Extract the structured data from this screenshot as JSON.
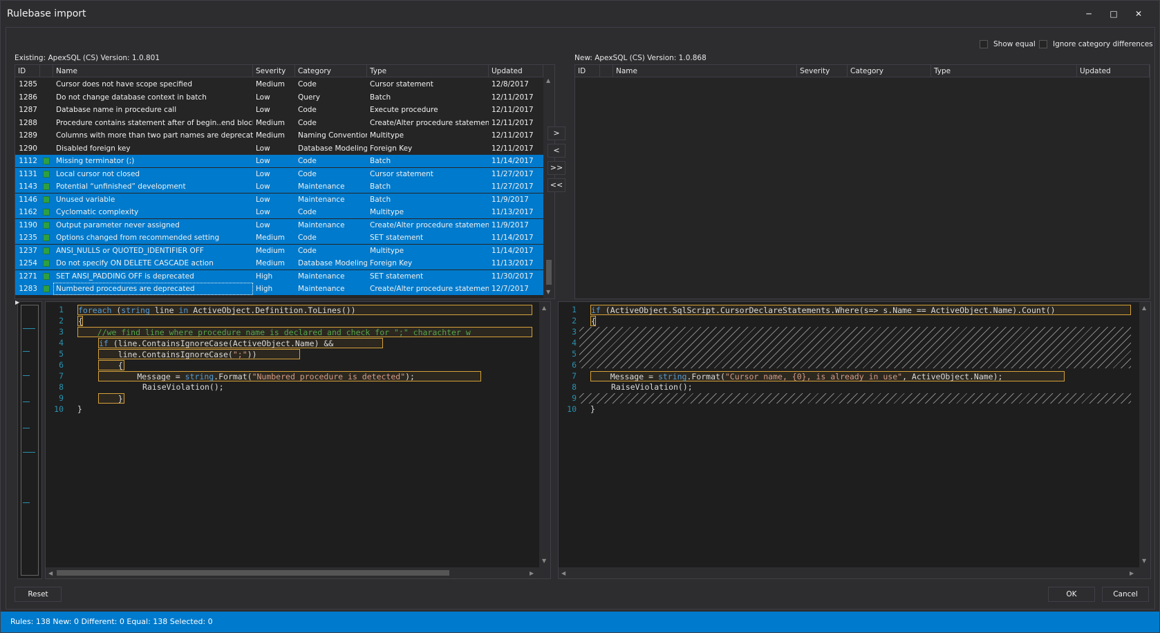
{
  "window": {
    "title": "Rulebase import"
  },
  "options": {
    "show_equal": "Show equal",
    "ignore_category": "Ignore category differences"
  },
  "existing": {
    "label": "Existing: ApexSQL (CS)  Version: 1.0.801",
    "columns": [
      "ID",
      "Name",
      "Severity",
      "Category",
      "Type",
      "Updated"
    ],
    "rows": [
      {
        "id": "1285",
        "name": "Cursor does not have scope specified",
        "severity": "Medium",
        "category": "Code",
        "type": "Cursor statement",
        "updated": "12/8/2017",
        "selected": false
      },
      {
        "id": "1286",
        "name": "Do not change database context in batch",
        "severity": "Low",
        "category": "Query",
        "type": "Batch",
        "updated": "12/11/2017",
        "selected": false
      },
      {
        "id": "1287",
        "name": "Database name in procedure call",
        "severity": "Low",
        "category": "Code",
        "type": "Execute procedure",
        "updated": "12/11/2017",
        "selected": false
      },
      {
        "id": "1288",
        "name": "Procedure contains statement after of begin..end block",
        "severity": "Medium",
        "category": "Code",
        "type": "Create/Alter procedure statement",
        "updated": "12/11/2017",
        "selected": false
      },
      {
        "id": "1289",
        "name": "Columns with more than two part names are deprecated",
        "severity": "Medium",
        "category": "Naming Convention",
        "type": "Multitype",
        "updated": "12/11/2017",
        "selected": false
      },
      {
        "id": "1290",
        "name": "Disabled foreign key",
        "severity": "Low",
        "category": "Database Modeling",
        "type": "Foreign Key",
        "updated": "12/11/2017",
        "selected": false
      },
      {
        "id": "1112",
        "name": "Missing terminator (;)",
        "severity": "Low",
        "category": "Code",
        "type": "Batch",
        "updated": "11/14/2017",
        "selected": true
      },
      {
        "id": "1131",
        "name": "Local cursor not closed",
        "severity": "Low",
        "category": "Code",
        "type": "Cursor statement",
        "updated": "11/27/2017",
        "selected": true
      },
      {
        "id": "1143",
        "name": "Potential “unfinished” development",
        "severity": "Low",
        "category": "Maintenance",
        "type": "Batch",
        "updated": "11/27/2017",
        "selected": true
      },
      {
        "id": "1146",
        "name": "Unused variable",
        "severity": "Low",
        "category": "Maintenance",
        "type": "Batch",
        "updated": "11/9/2017",
        "selected": true
      },
      {
        "id": "1162",
        "name": "Cyclomatic complexity",
        "severity": "Low",
        "category": "Code",
        "type": "Multitype",
        "updated": "11/13/2017",
        "selected": true
      },
      {
        "id": "1190",
        "name": "Output parameter never assigned",
        "severity": "Low",
        "category": "Maintenance",
        "type": "Create/Alter procedure statement",
        "updated": "11/9/2017",
        "selected": true
      },
      {
        "id": "1235",
        "name": "Options changed from recommended setting",
        "severity": "Medium",
        "category": "Code",
        "type": "SET statement",
        "updated": "11/14/2017",
        "selected": true
      },
      {
        "id": "1237",
        "name": "ANSI_NULLS or QUOTED_IDENTIFIER  OFF",
        "severity": "Medium",
        "category": "Code",
        "type": "Multitype",
        "updated": "11/14/2017",
        "selected": true
      },
      {
        "id": "1254",
        "name": "Do not specify ON DELETE CASCADE action",
        "severity": "Medium",
        "category": "Database Modeling",
        "type": "Foreign Key",
        "updated": "11/13/2017",
        "selected": true
      },
      {
        "id": "1271",
        "name": "SET ANSI_PADDING OFF is deprecated",
        "severity": "High",
        "category": "Maintenance",
        "type": "SET statement",
        "updated": "11/30/2017",
        "selected": true
      },
      {
        "id": "1283",
        "name": "Numbered procedures are deprecated",
        "severity": "High",
        "category": "Maintenance",
        "type": "Create/Alter procedure statement",
        "updated": "12/7/2017",
        "selected": true
      }
    ]
  },
  "new": {
    "label": "New: ApexSQL (CS)  Version: 1.0.868",
    "columns": [
      "ID",
      "Name",
      "Severity",
      "Category",
      "Type",
      "Updated"
    ]
  },
  "transfer_buttons": [
    ">",
    "<",
    ">>",
    "<<"
  ],
  "left_code": {
    "lines": [
      "1",
      "2",
      "3",
      "4",
      "5",
      "6",
      "7",
      "8",
      "9",
      "10"
    ]
  },
  "right_code": {
    "lines": [
      "1",
      "2",
      "3",
      "4",
      "5",
      "6",
      "7",
      "8",
      "9",
      "10"
    ]
  },
  "buttons": {
    "reset": "Reset",
    "ok": "OK",
    "cancel": "Cancel"
  },
  "status": {
    "text": "Rules: 138   New: 0   Different: 0   Equal: 138   Selected: 0"
  }
}
